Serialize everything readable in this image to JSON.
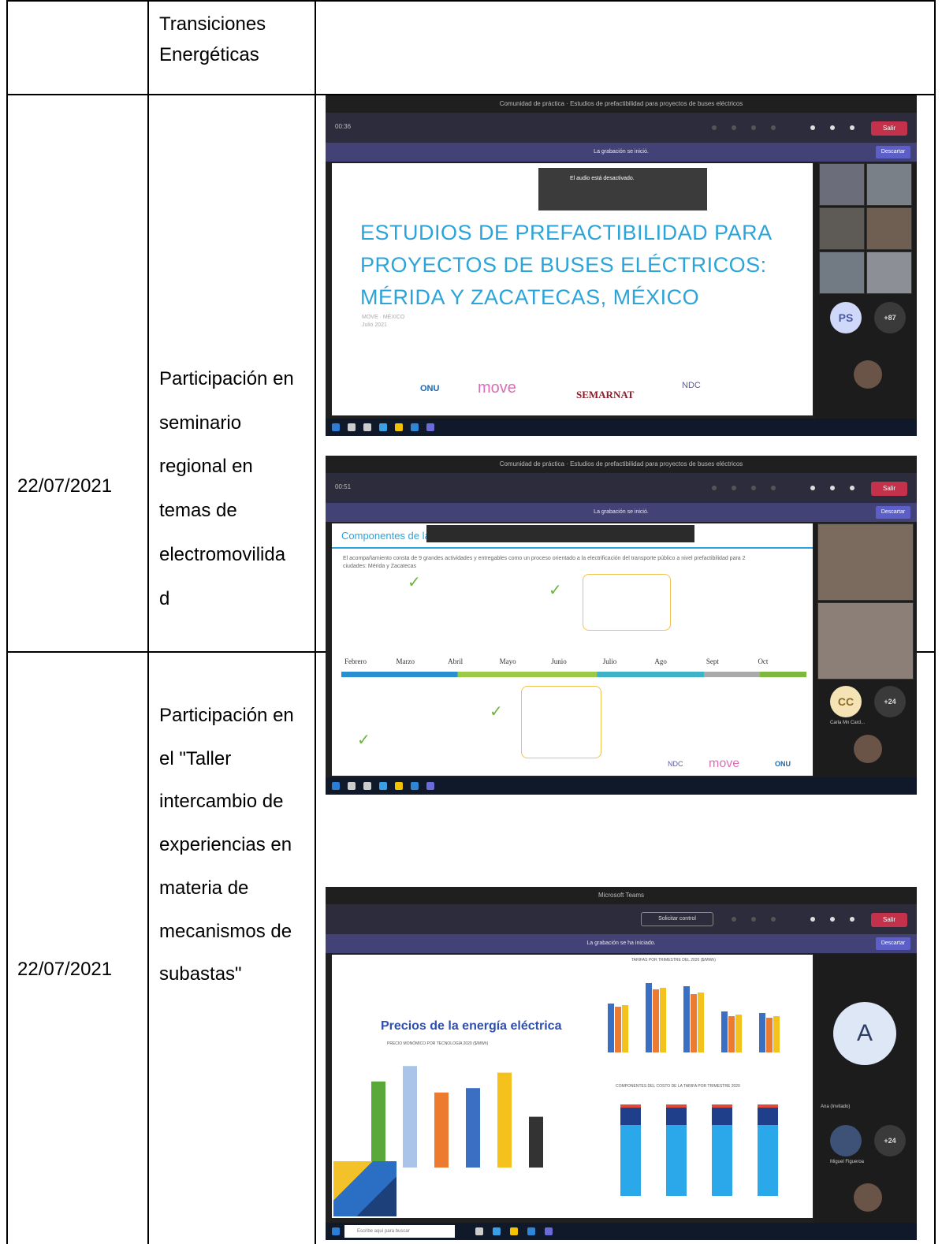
{
  "rows": [
    {
      "date": "",
      "activity": [
        "Transiciones",
        "Energéticas"
      ]
    },
    {
      "date": "22/07/2021",
      "activity": [
        "Participación en",
        "seminario",
        "regional en",
        "temas de",
        "electromovilida",
        "d"
      ]
    },
    {
      "date": "22/07/2021",
      "activity": [
        "Participación en",
        "el \"Taller",
        "intercambio de",
        "experiencias en",
        "materia de",
        "mecanismos de",
        "subastas\""
      ]
    }
  ],
  "screenshot1": {
    "window_title": "Comunidad de práctica · Estudios de prefactibilidad para proyectos de buses eléctricos",
    "timer": "00:36",
    "leave_label": "Salir",
    "recording_notice": "La grabación se inició.",
    "discard_label": "Descartar",
    "audio_toast_title": "El audio está desactivado.",
    "slide_title_lines": [
      "ESTUDIOS DE PREFACTIBILIDAD PARA",
      "PROYECTOS DE BUSES ELÉCTRICOS:",
      "MÉRIDA Y ZACATECAS, MÉXICO"
    ],
    "slide_subtitle": "MOVE · MÉXICO",
    "slide_date": "Julio 2021",
    "logos": [
      "ONU",
      "move",
      "SEMARNAT",
      "NDC"
    ],
    "participant_initials": "PS",
    "overflow_count": "+87",
    "accent_color": "#2aa4d9"
  },
  "screenshot2": {
    "window_title": "Comunidad de práctica · Estudios de prefactibilidad para proyectos de buses eléctricos",
    "timer": "00:51",
    "leave_label": "Salir",
    "recording_notice": "La grabación se inició.",
    "discard_label": "Descartar",
    "slide_heading": "Componentes de la",
    "slide_intro": "El acompañamiento consta de 9 grandes actividades y entregables como un proceso orientado a la electrificación del transporte público a nivel prefactibilidad para 2 ciudades: Mérida y Zacatecas",
    "months": [
      "Febrero",
      "Marzo",
      "Abril",
      "Mayo",
      "Junio",
      "Julio",
      "Ago",
      "Sept",
      "Oct"
    ],
    "participant_initials": "CC",
    "participant_name": "Carla Mn Card...",
    "overflow_count": "+24",
    "logos": [
      "NDC",
      "move",
      "ONU"
    ]
  },
  "screenshot3": {
    "window_title": "Microsoft Teams",
    "leave_label": "Salir",
    "request_control": "Solicitar control",
    "recording_notice": "La grabación se ha iniciado.",
    "discard_label": "Descartar",
    "slide_heading": "Precios de la energía eléctrica",
    "left_chart_title": "PRECIO MONÓMICO POR TECNOLOGÍA 2020 ($/MWh)",
    "right_top_title": "TARIFAS POR TRIMESTRE DEL 2020 ($/MWh)",
    "right_bottom_title": "COMPONENTES DEL COSTO DE LA TARIFA POR TRIMESTRE 2020",
    "participant_initial": "A",
    "participant_name": "Ana (Invitado)",
    "participant2_name": "Miguel Figueroa",
    "overflow_count": "+24",
    "search_placeholder": "Escribe aquí para buscar",
    "bar_colors": [
      "#5aa83a",
      "#a9c4e8",
      "#ec7b30",
      "#3b6fc4",
      "#f5c11c",
      "#333333"
    ]
  }
}
